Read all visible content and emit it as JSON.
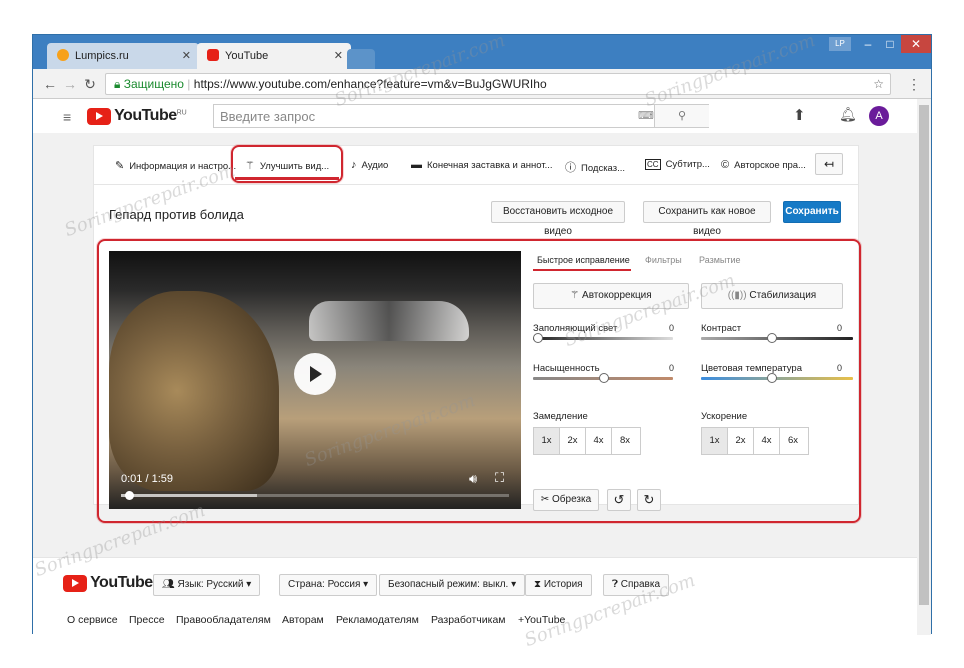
{
  "browser": {
    "tabs": [
      {
        "title": "Lumpics.ru",
        "favicon_color": "#f7a11b"
      },
      {
        "title": "YouTube",
        "favicon_color": "#e62117"
      }
    ],
    "window_badge": "LP",
    "url_secure_label": "Защищено",
    "url": "https://www.youtube.com/enhance?feature=vm&v=BuJgGWURIho"
  },
  "youtube": {
    "logo_text": "YouTube",
    "logo_region": "RU",
    "search_placeholder": "Введите запрос",
    "avatar_letter": "A",
    "avatar_color": "#6a1b9a"
  },
  "editor_tabs": [
    {
      "label": "Информация и настро...",
      "icon": "pencil-icon"
    },
    {
      "label": "Улучшить вид...",
      "icon": "magic-wand-icon",
      "highlighted": true
    },
    {
      "label": "Аудио",
      "icon": "music-note-icon"
    },
    {
      "label": "Конечная заставка и аннот...",
      "icon": "end-screen-icon"
    },
    {
      "label": "Подсказ...",
      "icon": "info-icon"
    },
    {
      "label": "Субтитр...",
      "icon": "cc-icon"
    },
    {
      "label": "Авторское пра...",
      "icon": "copyright-icon"
    }
  ],
  "video_title": "Гепард против болида",
  "actions": {
    "restore": "Восстановить исходное видео",
    "save_new": "Сохранить как новое видео",
    "save": "Сохранить"
  },
  "player": {
    "time": "0:01 / 1:59",
    "progress": 0.01
  },
  "panel_tabs": {
    "quick_fix": "Быстрое исправление",
    "filters": "Фильтры",
    "blur": "Размытие"
  },
  "quick_fix": {
    "autocorrect": "Автокоррекция",
    "stabilize": "Стабилизация",
    "fill_light": {
      "label": "Заполняющий свет",
      "value": "0"
    },
    "contrast": {
      "label": "Контраст",
      "value": "0"
    },
    "saturation": {
      "label": "Насыщенность",
      "value": "0"
    },
    "color_temp": {
      "label": "Цветовая температура",
      "value": "0"
    },
    "slowdown": {
      "label": "Замедление",
      "options": [
        "1x",
        "2x",
        "4x",
        "8x"
      ]
    },
    "speedup": {
      "label": "Ускорение",
      "options": [
        "1x",
        "2x",
        "4x",
        "6x"
      ]
    },
    "trim": "Обрезка"
  },
  "footer": {
    "logo_text": "YouTube",
    "language": "Язык: Русский",
    "country": "Страна: Россия",
    "safe_mode": "Безопасный режим: выкл.",
    "history": "История",
    "help": "Справка",
    "links": [
      "О сервисе",
      "Прессе",
      "Правообладателям",
      "Авторам",
      "Рекламодателям",
      "Разработчикам",
      "+YouTube"
    ]
  },
  "watermark": "Soringpcrepair.com",
  "colors": {
    "accent_blue": "#167ac6",
    "highlight_red": "#d0262f",
    "youtube_red": "#e62117"
  }
}
